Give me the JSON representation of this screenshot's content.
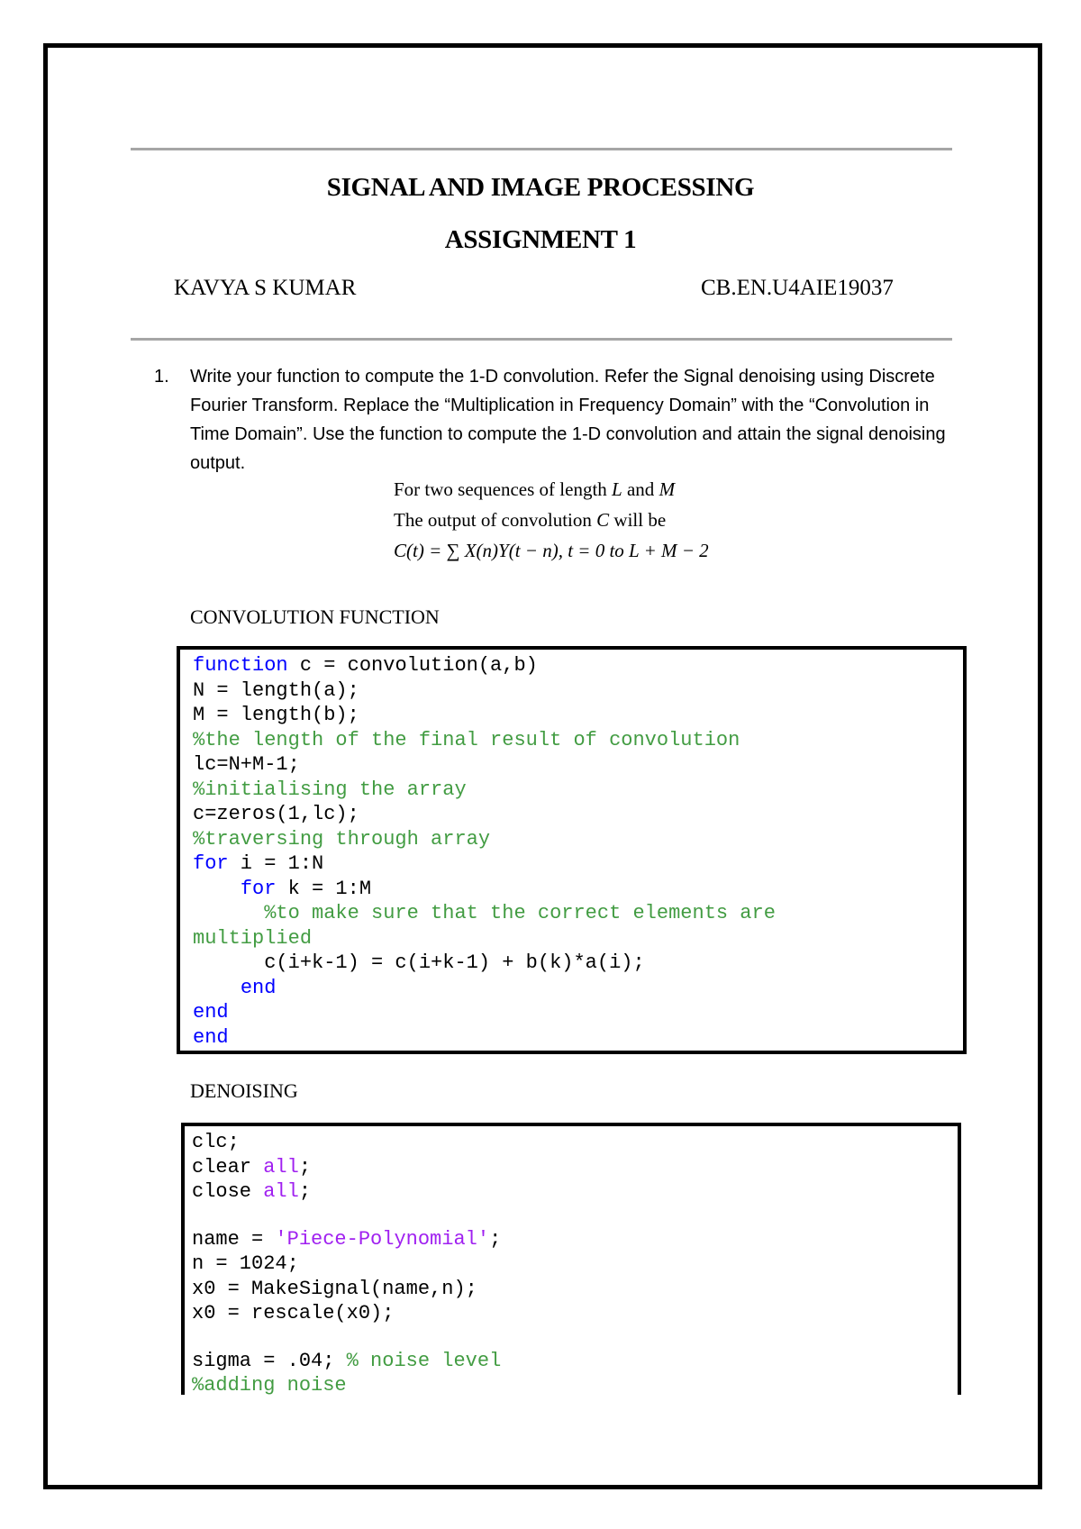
{
  "header": {
    "title": "SIGNAL AND IMAGE PROCESSING",
    "subtitle": "ASSIGNMENT 1",
    "student_name": "KAVYA S KUMAR",
    "roll_number": "CB.EN.U4AIE19037"
  },
  "question": {
    "number": "1.",
    "text": "Write your function to compute the 1-D convolution. Refer the Signal denoising using Discrete Fourier Transform. Replace the “Multiplication in Frequency Domain” with the “Convolution in Time Domain”. Use the function to compute the 1-D convolution and attain the signal denoising output."
  },
  "formula": {
    "line1_prefix": "For two sequences of length ",
    "line1_var1": "L",
    "line1_and": " and ",
    "line1_var2": "M",
    "line2_prefix": "The output of convolution ",
    "line2_var": "C",
    "line2_suffix": " will be",
    "line3": "C(t) = ∑ X(n)Y(t − n),  t = 0 to L + M − 2"
  },
  "sections": {
    "convolution_label": "CONVOLUTION FUNCTION",
    "denoising_label": "DENOISING"
  },
  "colors": {
    "keyword": "#0000ff",
    "comment": "#228b22",
    "string": "#a020f0",
    "rule": "#a6a6a6",
    "border": "#000000"
  },
  "convolution_code": [
    [
      {
        "t": "kw",
        "s": "function"
      },
      {
        "t": "",
        "s": " c = convolution(a,b)"
      }
    ],
    [
      {
        "t": "",
        "s": "N = length(a);"
      }
    ],
    [
      {
        "t": "",
        "s": "M = length(b);"
      }
    ],
    [
      {
        "t": "cm",
        "s": "%the length of the final result of convolution"
      }
    ],
    [
      {
        "t": "",
        "s": "lc=N+M-1;"
      }
    ],
    [
      {
        "t": "cm",
        "s": "%initialising the array"
      }
    ],
    [
      {
        "t": "",
        "s": "c=zeros(1,lc);"
      }
    ],
    [
      {
        "t": "cm",
        "s": "%traversing through array"
      }
    ],
    [
      {
        "t": "kw",
        "s": "for"
      },
      {
        "t": "",
        "s": " i = 1:N"
      }
    ],
    [
      {
        "t": "",
        "s": "    "
      },
      {
        "t": "kw",
        "s": "for"
      },
      {
        "t": "",
        "s": " k = 1:M"
      }
    ],
    [
      {
        "t": "cm",
        "s": "      %to make sure that the correct elements are"
      }
    ],
    [
      {
        "t": "cm",
        "s": "multiplied"
      }
    ],
    [
      {
        "t": "",
        "s": "      c(i+k-1) = c(i+k-1) + b(k)*a(i);"
      }
    ],
    [
      {
        "t": "",
        "s": "    "
      },
      {
        "t": "kw",
        "s": "end"
      }
    ],
    [
      {
        "t": "kw",
        "s": "end"
      }
    ],
    [
      {
        "t": "kw",
        "s": "end"
      }
    ]
  ],
  "denoising_code": [
    [
      {
        "t": "",
        "s": "clc;"
      }
    ],
    [
      {
        "t": "",
        "s": "clear "
      },
      {
        "t": "str",
        "s": "all"
      },
      {
        "t": "",
        "s": ";"
      }
    ],
    [
      {
        "t": "",
        "s": "close "
      },
      {
        "t": "str",
        "s": "all"
      },
      {
        "t": "",
        "s": ";"
      }
    ],
    [],
    [
      {
        "t": "",
        "s": "name = "
      },
      {
        "t": "str",
        "s": "'Piece-Polynomial'"
      },
      {
        "t": "",
        "s": ";"
      }
    ],
    [
      {
        "t": "",
        "s": "n = 1024;"
      }
    ],
    [
      {
        "t": "",
        "s": "x0 = MakeSignal(name,n);"
      }
    ],
    [
      {
        "t": "",
        "s": "x0 = rescale(x0);"
      }
    ],
    [],
    [
      {
        "t": "",
        "s": "sigma = .04; "
      },
      {
        "t": "cm",
        "s": "% noise level"
      }
    ],
    [
      {
        "t": "cm",
        "s": "%adding noise"
      }
    ]
  ]
}
